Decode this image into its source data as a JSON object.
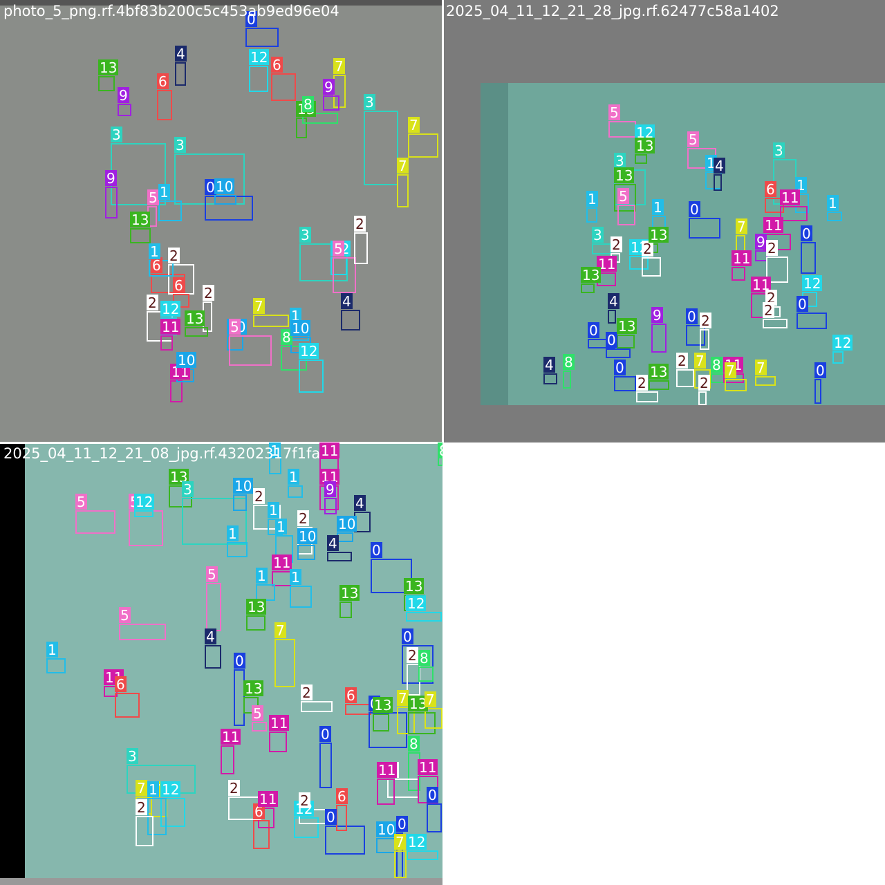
{
  "mosaic": {
    "tiles": [
      {
        "title": "photo_5_png.rf.4bf83b200c5c453ab9ed96e04"
      },
      {
        "title": "2025_04_11_12_21_28_jpg.rf.62477c58a1402"
      },
      {
        "title": "2025_04_11_12_21_08_jpg.rf.43202317f1fa"
      }
    ]
  },
  "class_colors": {
    "0": "#1a3fe0",
    "1": "#22bde8",
    "2": "#ffffff",
    "3": "#2dd4c0",
    "4": "#1b2a6b",
    "5": "#f070c8",
    "6": "#ef4a4a",
    "7": "#d9e21a",
    "8": "#2fe06a",
    "9": "#a020e0",
    "10": "#1aa6e8",
    "11": "#d21aa8",
    "12": "#22d8e8",
    "13": "#3ab520"
  }
}
